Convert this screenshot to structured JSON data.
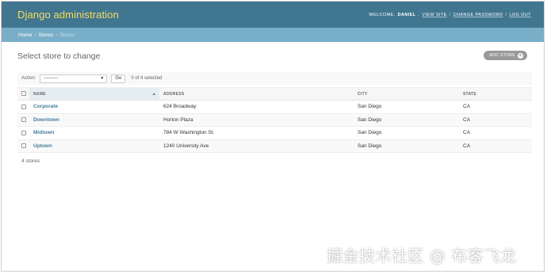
{
  "header": {
    "brand": "Django administration",
    "welcome_prefix": "WELCOME,",
    "username": "DANIEL",
    "links": [
      "VIEW SITE",
      "CHANGE PASSWORD",
      "LOG OUT"
    ],
    "separator": "/",
    "colors": {
      "bar": "#417690",
      "brand": "#f5dd5d"
    }
  },
  "breadcrumbs": {
    "items": [
      "Home",
      "Stores",
      "Stores"
    ],
    "separator": "›",
    "color": "#79aec8"
  },
  "page": {
    "title": "Select store to change",
    "add_button": "ADD STORE",
    "add_icon": "plus-icon"
  },
  "actions": {
    "label": "Action:",
    "selected_value": "---------",
    "go_label": "Go",
    "selection_counter": "0 of 4 selected"
  },
  "table": {
    "columns": [
      "NAME",
      "ADDRESS",
      "CITY",
      "STATE"
    ],
    "sorted_column": "NAME",
    "rows": [
      {
        "name": "Corporate",
        "address": "624 Broadway",
        "city": "San Diego",
        "state": "CA"
      },
      {
        "name": "Downtown",
        "address": "Horton Plaza",
        "city": "San Diego",
        "state": "CA"
      },
      {
        "name": "Midtown",
        "address": "784 W Washington St.",
        "city": "San Diego",
        "state": "CA"
      },
      {
        "name": "Uptown",
        "address": "1240 University Ave",
        "city": "San Diego",
        "state": "CA"
      }
    ]
  },
  "paginator": {
    "count_text": "4 stores"
  },
  "watermark": {
    "text": "掘金技术社区 @ 布客飞龙"
  }
}
